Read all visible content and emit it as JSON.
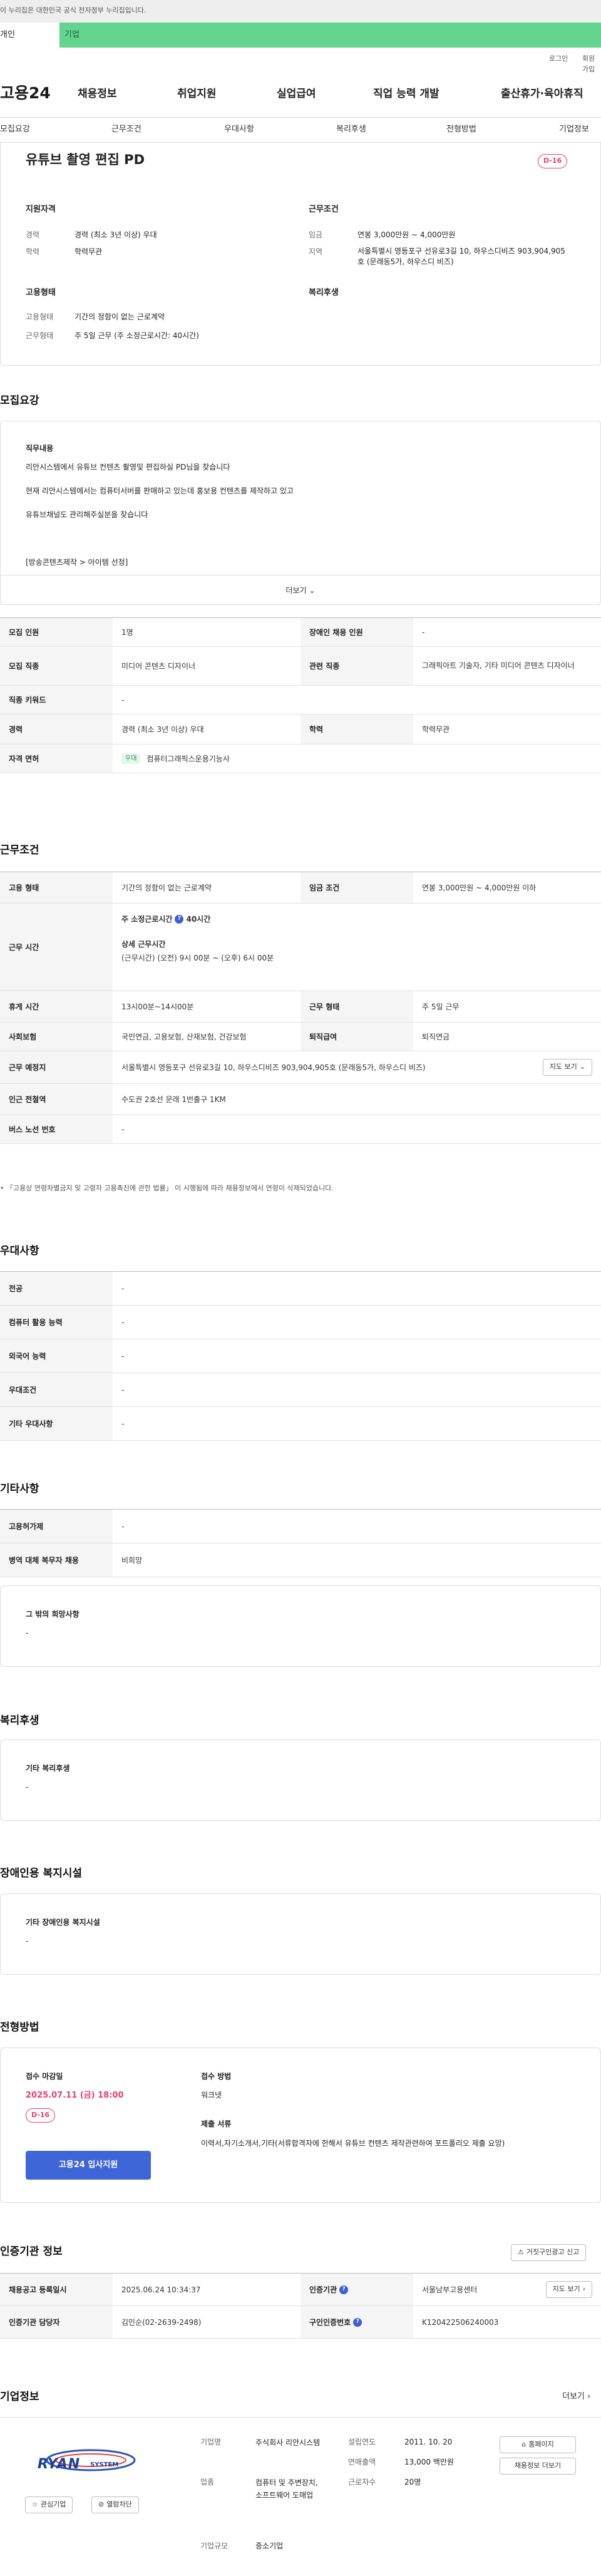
{
  "gov_notice": "이 누리집은 대한민국 공식 전자정부 누리집입니다.",
  "tabs": [
    "개인",
    "기업"
  ],
  "util_links": [
    "로그인",
    "회원가입"
  ],
  "logo": "고용24",
  "gnb": [
    "채용정보",
    "취업지원",
    "실업급여",
    "직업 능력 개발",
    "출산휴가·육아휴직"
  ],
  "subnav": [
    "모집요강",
    "근무조건",
    "우대사항",
    "복리후생",
    "전형방법",
    "기업정보"
  ],
  "job": {
    "title": "유튜브 촬영 편집 PD",
    "dday": "D-16",
    "qual_title": "지원자격",
    "qual": [
      {
        "label": "경력",
        "value": "경력 (최소 3년 이상) 우대"
      },
      {
        "label": "학력",
        "value": "학력무관"
      }
    ],
    "cond_title": "근무조건",
    "cond": [
      {
        "label": "임금",
        "value": "연봉 3,000만원 ~ 4,000만원"
      },
      {
        "label": "지역",
        "value": "서울특별시 영등포구 선유로3길 10, 하우스디비즈 903,904,905호 (문래동5가, 하우스디 비즈)"
      }
    ],
    "emp_title": "고용형태",
    "emp": [
      {
        "label": "고용형태",
        "value": "기간의 정함이 없는 근로계약"
      },
      {
        "label": "근무형태",
        "value": "주 5일 근무 (주 소정근로시간: 40시간)"
      }
    ],
    "welfare_title": "복리후생"
  },
  "recruit": {
    "title": "모집요강",
    "duty_label": "직무내용",
    "lines": [
      "리안시스템에서 유튜브 컨텐츠 촬영및 편집하실 PD님을 찾습니다",
      "현재 리안시스템에서는 컴퓨터서버를 판매하고 있는데 홍보용 컨텐츠를 제작하고 있고",
      "유튜브채널도 관리해주실분을 찾습니다",
      "[방송콘텐츠제작 > 아이템 선정]"
    ],
    "more": "더보기"
  },
  "recruit_table": {
    "r1": {
      "h1": "모집 인원",
      "v1": "1명",
      "h2": "장애인 채용 인원",
      "v2": "-"
    },
    "r2": {
      "h1": "모집 직종",
      "v1": "미디어 콘텐츠 디자이너",
      "h2": "관련 직종",
      "v2": "그래픽아트 기술자, 기타 미디어 콘텐츠 디자이너"
    },
    "r3": {
      "h1": "직종 키워드",
      "v1": "-"
    },
    "r4": {
      "h1": "경력",
      "v1": "경력 (최소 3년 이상) 우대",
      "h2": "학력",
      "v2": "학력무관"
    },
    "r5": {
      "h1": "자격 면허",
      "tag": "우대",
      "v1": "컴퓨터그래픽스운용기능사"
    }
  },
  "work": {
    "title": "근무조건",
    "r1": {
      "h1": "고용 형태",
      "v1": "기간의 정함이 없는 근로계약",
      "h2": "임금 조건",
      "v2": "연봉 3,000만원 ~ 4,000만원 이하"
    },
    "r2": {
      "h1": "근무 시간",
      "week_label": "주 소정근로시간",
      "week_value": "40시간",
      "detail_label": "상세 근무시간",
      "detail_value": "(근무시간) (오전) 9시 00분 ~ (오후) 6시 00분"
    },
    "r3": {
      "h1": "휴게 시간",
      "v1": "13시00분~14시00분",
      "h2": "근무 형태",
      "v2": "주 5일 근무"
    },
    "r4": {
      "h1": "사회보험",
      "v1": "국민연금, 고용보험, 산재보험, 건강보험",
      "h2": "퇴직급여",
      "v2": "퇴직연금"
    },
    "r5": {
      "h1": "근무 예정지",
      "v1": "서울특별시 영등포구 선유로3길 10, 하우스디비즈 903,904,905호 (문래동5가, 하우스디 비즈)",
      "btn": "지도 보기"
    },
    "r6": {
      "h1": "인근 전철역",
      "v1": "수도권 2호선 문래 1번출구 1KM"
    },
    "r7": {
      "h1": "버스 노선 번호",
      "v1": "-"
    },
    "note": "「고용상 연령차별금지 및 고령자 고용촉진에 관한 법률」 이 시행됨에 따라 채용정보에서 연령이 삭제되었습니다."
  },
  "pref": {
    "title": "우대사항",
    "rows": [
      {
        "h": "전공",
        "v": "-"
      },
      {
        "h": "컴퓨터 활용 능력",
        "v": "-"
      },
      {
        "h": "외국어 능력",
        "v": "-"
      },
      {
        "h": "우대조건",
        "v": "-"
      },
      {
        "h": "기타 우대사항",
        "v": "-"
      }
    ]
  },
  "etc": {
    "title": "기타사항",
    "rows": [
      {
        "h": "고용허가제",
        "v": "-"
      },
      {
        "h": "병역 대체 복무자 채용",
        "v": "비희망"
      }
    ],
    "box_label": "그 밖의 희망사항",
    "box_value": "-"
  },
  "welfare": {
    "title": "복리후생",
    "label": "기타 복리후생",
    "value": "-"
  },
  "disability": {
    "title": "장애인용 복지시설",
    "label": "기타 장애인용 복지시설",
    "value": "-"
  },
  "screening": {
    "title": "전형방법",
    "deadline_label": "접수 마감일",
    "deadline": "2025.07.11 (금) 18:00",
    "dday": "D-16",
    "apply_btn": "고용24 입사지원",
    "method_label": "접수 방법",
    "method": "워크넷",
    "docs_label": "제출 서류",
    "docs": "이력서,자기소개서,기타(서류합격자에 한해서 유튜브 컨텐츠 제작관련하여 포트폴리오 제출 요망)"
  },
  "cert": {
    "title": "인증기관 정보",
    "report_btn": "거짓구인광고 신고",
    "r1": {
      "h1": "채용공고 등록일시",
      "v1": "2025.06.24 10:34:37",
      "h2": "인증기관",
      "v2": "서울남부고용센터",
      "btn": "지도 보기"
    },
    "r2": {
      "h1": "인증기관 담당자",
      "v1": "김민순(02-2639-2498)",
      "h2": "구인인증번호",
      "v2": "K120422506240003"
    }
  },
  "company": {
    "title": "기업정보",
    "more": "더보기",
    "logo_text": "RYAN",
    "logo_sub": "SYSTEM",
    "fav_btn": "관심기업",
    "block_btn": "열람차단",
    "name_label": "기업명",
    "name": "주식회사 리안시스템",
    "biz_label": "업종",
    "biz": "컴퓨터 및 주변장치, 소프트웨어 도매업",
    "scale_label": "기업규모",
    "scale": "중소기업",
    "found_label": "설립연도",
    "found": "2011. 10. 20",
    "sales_label": "연매출액",
    "sales": "13,000 백만원",
    "emp_label": "근로자수",
    "emp": "20명",
    "home_btn": "홈페이지",
    "jobs_btn": "채용정보 더보기"
  }
}
